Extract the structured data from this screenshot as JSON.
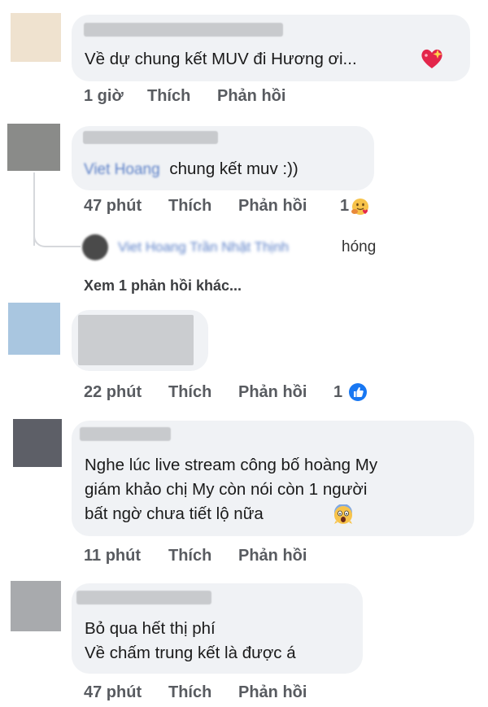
{
  "colors": {
    "bubble_bg": "#f0f2f5",
    "action_text": "#585b60",
    "link_blue": "#5a7fc7",
    "like_blue": "#1877f2"
  },
  "comments": [
    {
      "avatar_color": "#efe2cf",
      "text_lines": [
        "Về dự chung kết MUV đi Hương ơi..."
      ],
      "trailing_icon": "sparkling-heart-emoji",
      "time": "1 giờ",
      "like_label": "Thích",
      "reply_label": "Phản hồi"
    },
    {
      "avatar_color": "#8a8b89",
      "mention": "Viet Hoang",
      "text_lines": [
        "chung kết muv :))"
      ],
      "time": "47 phút",
      "like_label": "Thích",
      "reply_label": "Phản hồi",
      "reaction_count": "1",
      "reaction_icon": "hugging-reaction-icon",
      "reply": {
        "avatar_color": "#4a4a4a",
        "blurred_names": "Viet Hoang Trần Nhật Thịnh",
        "text": "hóng"
      },
      "more_replies_label": "Xem 1 phản hồi khác..."
    },
    {
      "avatar_color": "#a9c6e0",
      "text_lines": [],
      "time": "22 phút",
      "like_label": "Thích",
      "reply_label": "Phản hồi",
      "reaction_count": "1",
      "reaction_icon": "like-reaction-icon"
    },
    {
      "avatar_color": "#5d5f67",
      "text_lines": [
        "Nghe lúc live stream công bố hoàng My",
        "giám khảo chị My còn nói còn 1 người",
        "bất ngờ chưa tiết lộ nữa"
      ],
      "trailing_icon": "screaming-face-emoji",
      "time": "11 phút",
      "like_label": "Thích",
      "reply_label": "Phản hồi"
    },
    {
      "avatar_color": "#a8aaad",
      "text_lines": [
        "Bỏ qua hết thị phí",
        "Về chấm trung kết là được á"
      ],
      "time": "47 phút",
      "like_label": "Thích",
      "reply_label": "Phản hồi"
    }
  ]
}
